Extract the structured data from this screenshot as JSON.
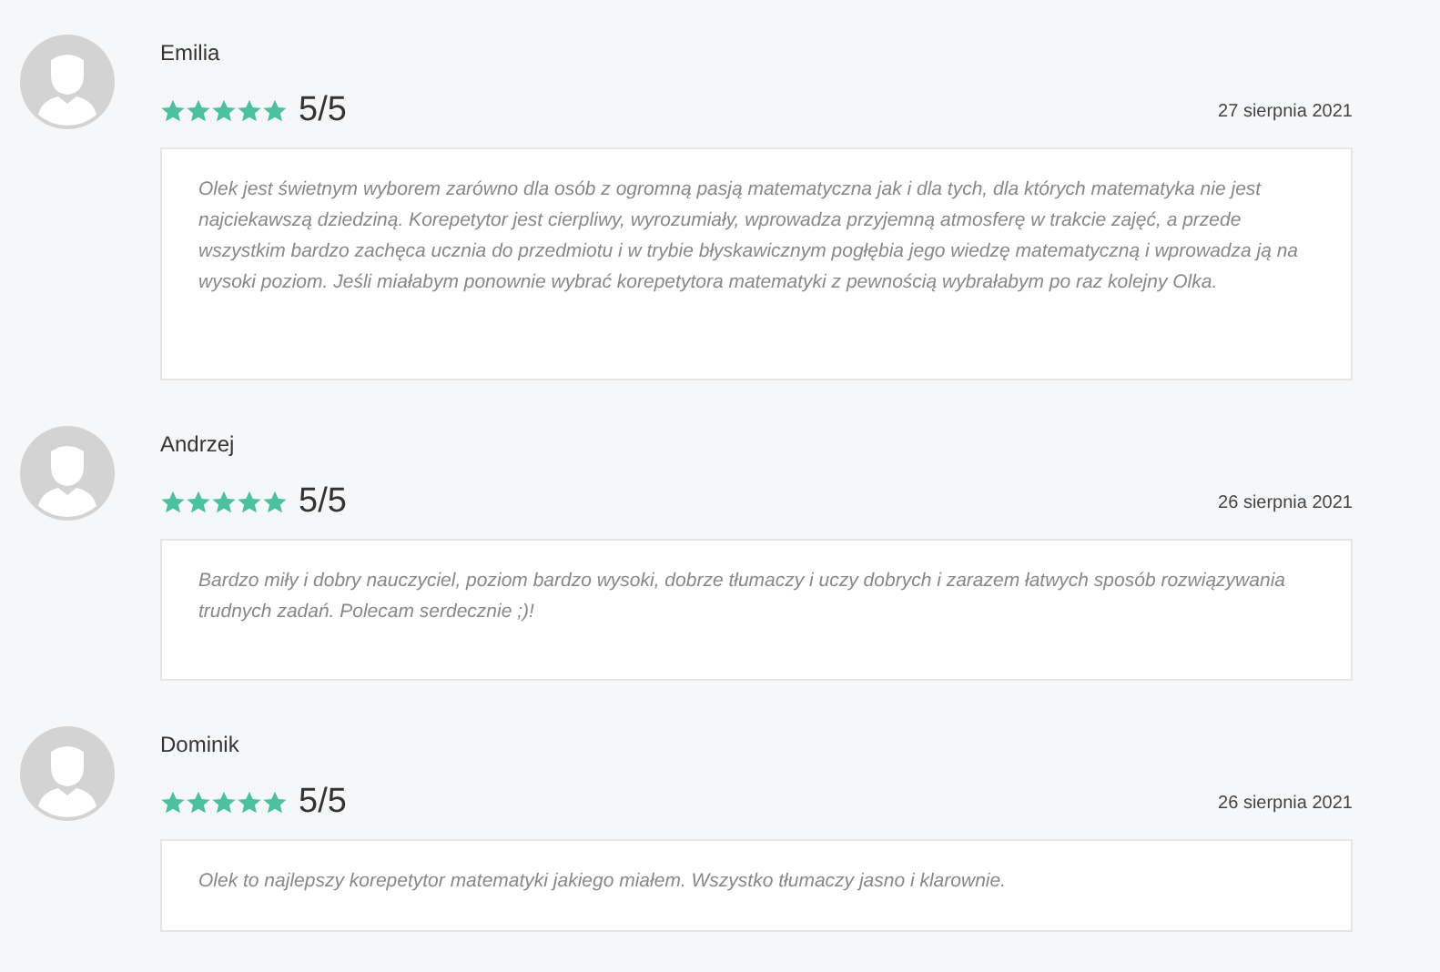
{
  "reviews": [
    {
      "name": "Emilia",
      "stars": 5,
      "rating": "5/5",
      "date": "27 sierpnia 2021",
      "text": "Olek jest świetnym wyborem zarówno dla osób z ogromną pasją matematyczna jak i dla tych, dla których matematyka nie jest najciekawszą dziedziną. Korepetytor jest cierpliwy, wyrozumiały, wprowadza przyjemną atmosferę w trakcie zajęć, a przede wszystkim bardzo zachęca ucznia do przedmiotu i w trybie błyskawicznym pogłębia jego wiedzę matematyczną i wprowadza ją na wysoki poziom. Jeśli miałabym ponownie wybrać korepetytora matematyki z pewnością wybrałabym po raz kolejny Olka."
    },
    {
      "name": "Andrzej",
      "stars": 5,
      "rating": "5/5",
      "date": "26 sierpnia 2021",
      "text": "Bardzo miły i dobry nauczyciel, poziom bardzo wysoki, dobrze tłumaczy i uczy dobrych i zarazem łatwych sposób rozwiązywania trudnych zadań. Polecam serdecznie ;)!"
    },
    {
      "name": "Dominik",
      "stars": 5,
      "rating": "5/5",
      "date": "26 sierpnia 2021",
      "text": "Olek to najlepszy korepetytor matematyki jakiego miałem. Wszystko tłumaczy jasno i klarownie."
    }
  ]
}
